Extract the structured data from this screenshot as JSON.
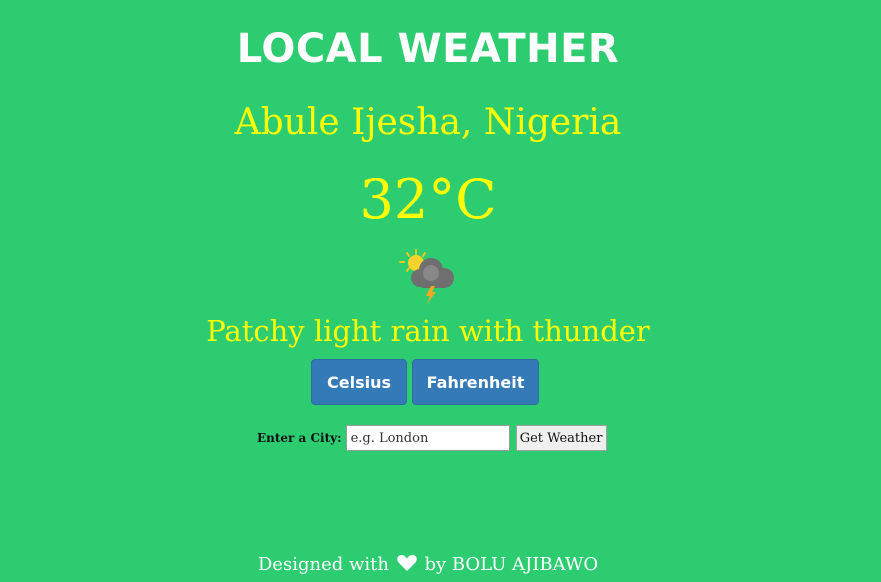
{
  "header": {
    "title": "LOCAL WEATHER"
  },
  "weather": {
    "location": "Abule Ijesha, Nigeria",
    "temperature": "32°C",
    "condition": "Patchy light rain with thunder",
    "icon": "sun-cloud-lightning-icon"
  },
  "units": {
    "celsius_label": "Celsius",
    "fahrenheit_label": "Fahrenheit"
  },
  "search": {
    "label": "Enter a City:",
    "placeholder": "e.g. London",
    "button_label": "Get Weather"
  },
  "footer": {
    "prefix": "Designed with",
    "suffix": "by BOLU AJIBAWO",
    "heart_icon": "heart-icon"
  },
  "colors": {
    "background": "#2ecc71",
    "accent_yellow": "#ffff00",
    "button_blue": "#337ab7"
  }
}
